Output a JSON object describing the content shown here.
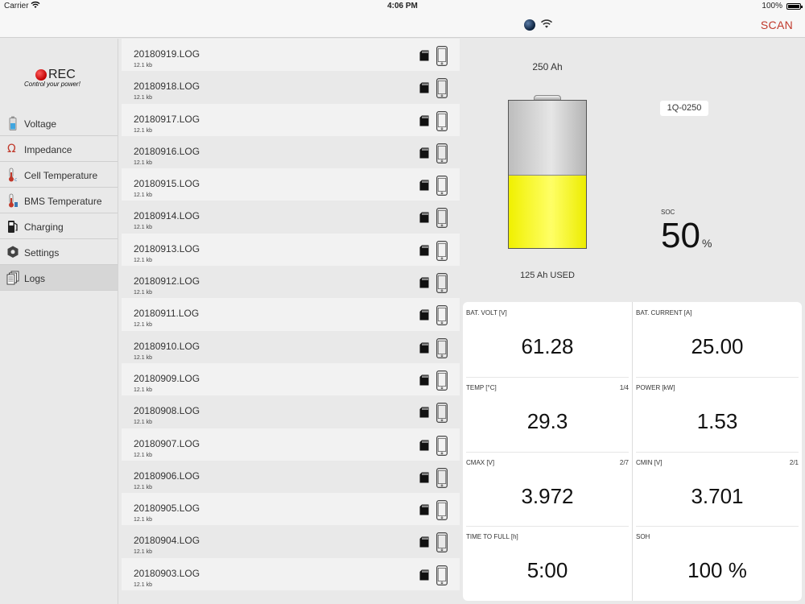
{
  "status": {
    "carrier": "Carrier",
    "time": "4:06 PM",
    "battery_pct": "100%"
  },
  "nav": {
    "scan_label": "SCAN"
  },
  "logo": {
    "brand": "REC",
    "tagline": "Control your power!"
  },
  "menu": [
    {
      "label": "Voltage",
      "icon": "battery-icon"
    },
    {
      "label": "Impedance",
      "icon": "omega-icon"
    },
    {
      "label": "Cell Temperature",
      "icon": "thermometer-icon"
    },
    {
      "label": "BMS Temperature",
      "icon": "thermometer-icon"
    },
    {
      "label": "Charging",
      "icon": "fuel-pump-icon"
    },
    {
      "label": "Settings",
      "icon": "hexagon-nut-icon"
    },
    {
      "label": "Logs",
      "icon": "documents-icon",
      "active": true
    }
  ],
  "logs": [
    {
      "name": "20180919.LOG",
      "size": "12.1 kb"
    },
    {
      "name": "20180918.LOG",
      "size": "12.1 kb"
    },
    {
      "name": "20180917.LOG",
      "size": "12.1 kb"
    },
    {
      "name": "20180916.LOG",
      "size": "12.1 kb"
    },
    {
      "name": "20180915.LOG",
      "size": "12.1 kb"
    },
    {
      "name": "20180914.LOG",
      "size": "12.1 kb"
    },
    {
      "name": "20180913.LOG",
      "size": "12.1 kb"
    },
    {
      "name": "20180912.LOG",
      "size": "12.1 kb"
    },
    {
      "name": "20180911.LOG",
      "size": "12.1 kb"
    },
    {
      "name": "20180910.LOG",
      "size": "12.1 kb"
    },
    {
      "name": "20180909.LOG",
      "size": "12.1 kb"
    },
    {
      "name": "20180908.LOG",
      "size": "12.1 kb"
    },
    {
      "name": "20180907.LOG",
      "size": "12.1 kb"
    },
    {
      "name": "20180906.LOG",
      "size": "12.1 kb"
    },
    {
      "name": "20180905.LOG",
      "size": "12.1 kb"
    },
    {
      "name": "20180904.LOG",
      "size": "12.1 kb"
    },
    {
      "name": "20180903.LOG",
      "size": "12.1 kb"
    }
  ],
  "battery": {
    "capacity": "250 Ah",
    "used": "125 Ah USED",
    "level": 0.5,
    "serial": "1Q-0250",
    "soc_label": "SOC",
    "soc_value": "50",
    "soc_unit": "%"
  },
  "metrics": [
    {
      "label": "BAT. VOLT [V]",
      "index": "",
      "value": "61.28"
    },
    {
      "label": "BAT. CURRENT [A]",
      "index": "",
      "value": "25.00"
    },
    {
      "label": "TEMP [°C]",
      "index": "1/4",
      "value": "29.3"
    },
    {
      "label": "POWER [kW]",
      "index": "",
      "value": "1.53"
    },
    {
      "label": "CMAX [V]",
      "index": "2/7",
      "value": "3.972"
    },
    {
      "label": "CMIN [V]",
      "index": "2/1",
      "value": "3.701"
    },
    {
      "label": "TIME TO FULL [h]",
      "index": "",
      "value": "5:00"
    },
    {
      "label": "SOH",
      "index": "",
      "value": "100 %"
    }
  ],
  "colors": {
    "accent": "#c0392b",
    "battery_fill": "#ffff33"
  }
}
